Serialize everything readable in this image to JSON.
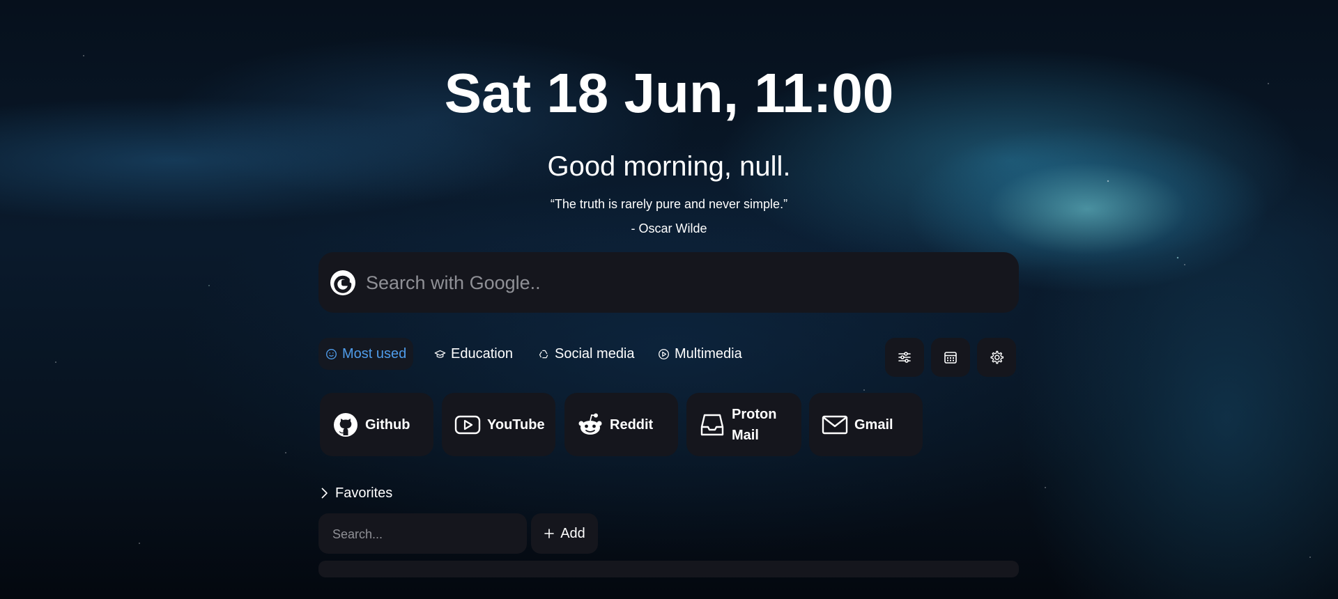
{
  "header": {
    "datetime": "Sat 18 Jun, 11:00",
    "greeting": "Good morning, null.",
    "quote": "“The truth is rarely pure and never simple.”",
    "author": "- Oscar Wilde"
  },
  "search": {
    "placeholder": "Search with Google..",
    "value": "",
    "engine_icon": "google-icon"
  },
  "tabs": [
    {
      "label": "Most used",
      "icon": "smile-icon",
      "active": true
    },
    {
      "label": "Education",
      "icon": "graduation-cap-icon",
      "active": false
    },
    {
      "label": "Social media",
      "icon": "recycle-icon",
      "active": false
    },
    {
      "label": "Multimedia",
      "icon": "play-circle-icon",
      "active": false
    }
  ],
  "toolbar": {
    "buttons": [
      {
        "icon": "sliders-icon"
      },
      {
        "icon": "calendar-icon"
      },
      {
        "icon": "gear-icon"
      }
    ]
  },
  "links": [
    {
      "label": "Github",
      "icon": "github-icon"
    },
    {
      "label": "YouTube",
      "icon": "youtube-icon"
    },
    {
      "label": "Reddit",
      "icon": "reddit-icon"
    },
    {
      "label": "Proton Mail",
      "icon": "inbox-icon"
    },
    {
      "label": "Gmail",
      "icon": "mail-icon"
    }
  ],
  "favorites": {
    "title": "Favorites",
    "search_placeholder": "Search...",
    "add_label": "Add"
  },
  "colors": {
    "panel": "#15161d",
    "accent": "#4f9cea",
    "text": "#ffffff",
    "placeholder": "#8f9096"
  }
}
